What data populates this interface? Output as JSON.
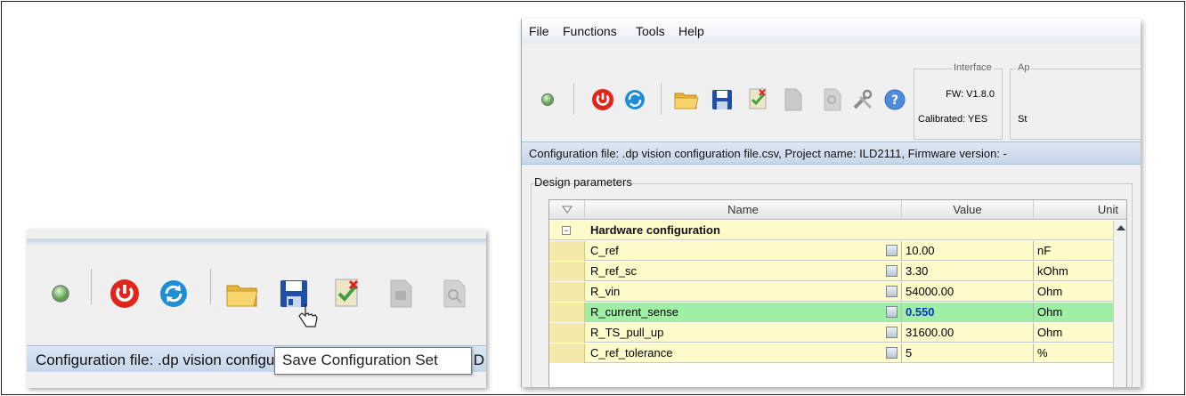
{
  "left": {
    "status_text": "Configuration file: .dp vision configuratio",
    "status_tail": ".D",
    "tooltip": "Save Configuration Set",
    "icons": [
      "status-led-icon",
      "power-icon",
      "refresh-icon",
      "open-folder-icon",
      "save-disk-icon",
      "check-document-icon",
      "document-icon",
      "search-document-icon"
    ]
  },
  "app": {
    "menu": [
      "File",
      "Functions",
      "Tools",
      "Help"
    ],
    "interface": {
      "legend": "Interface",
      "fw": "FW: V1.8.0",
      "calibrated": "Calibrated: YES"
    },
    "ap": {
      "legend": "Ap",
      "line2": "St"
    },
    "config_bar": "Configuration file: .dp vision configuration file.csv, Project name: ILD2111, Firmware version: -",
    "design_params_label": "Design parameters",
    "grid": {
      "headers": {
        "name": "Name",
        "value": "Value",
        "unit": "Unit"
      },
      "group": "Hardware configuration",
      "rows": [
        {
          "name": "C_ref",
          "value": "10.00",
          "unit": "nF",
          "highlight": false
        },
        {
          "name": "R_ref_sc",
          "value": "3.30",
          "unit": "kOhm",
          "highlight": false
        },
        {
          "name": "R_vin",
          "value": "54000.00",
          "unit": "Ohm",
          "highlight": false
        },
        {
          "name": "R_current_sense",
          "value": "0.550",
          "unit": "Ohm",
          "highlight": true
        },
        {
          "name": "R_TS_pull_up",
          "value": "31600.00",
          "unit": "Ohm",
          "highlight": false
        },
        {
          "name": "C_ref_tolerance",
          "value": "5",
          "unit": "%",
          "highlight": false
        }
      ]
    },
    "colors": {
      "row_yellow": "#fdfbc9",
      "row_green": "#9ff0a4",
      "highlight_value": "#0b2fd1",
      "power_red": "#e0251b",
      "refresh_blue": "#1e8fd6"
    }
  }
}
